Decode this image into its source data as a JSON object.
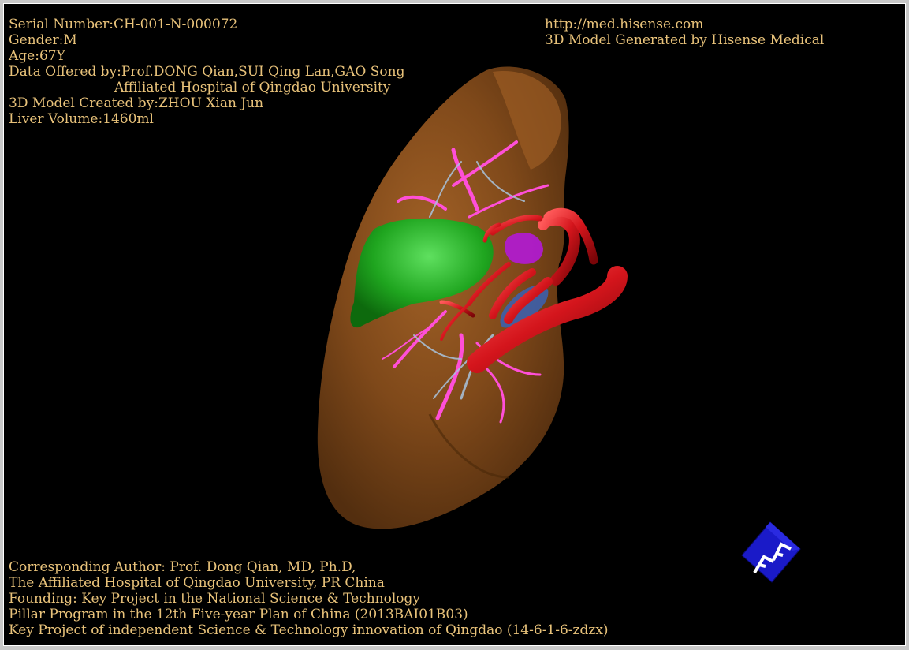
{
  "colors": {
    "text": "#e8c27a",
    "background": "#000000",
    "liver": "#8a4f1c",
    "gallbladder": "#1fa51f",
    "artery": "#d4151c",
    "vein": "#ff4fd8",
    "portal_vein": "#a9c4de",
    "cube": "#1616c8"
  },
  "info": {
    "serial": "Serial Number:CH-001-N-000072",
    "gender": "Gender:M",
    "age": "Age:67Y",
    "offered": "Data Offered by:Prof.DONG Qian,SUI Qing Lan,GAO Song",
    "hospital": "Affiliated Hospital of Qingdao University",
    "created": "3D Model Created by:ZHOU Xian Jun",
    "volume": "Liver Volume:1460ml"
  },
  "branding": {
    "url": "http://med.hisense.com",
    "generated": "3D Model Generated by Hisense Medical"
  },
  "footer": {
    "line1": "Corresponding Author: Prof. Dong Qian, MD, Ph.D,",
    "line2": "The Affiliated Hospital of Qingdao University, PR China",
    "line3": "Founding: Key Project in the National Science & Technology",
    "line4": "Pillar Program in the 12th Five-year Plan of China (2013BAI01B03)",
    "line5": "Key Project of independent Science & Technology innovation of Qingdao (14-6-1-6-zdzx)"
  },
  "orientation_cube": {
    "face_label": "FF",
    "icon": "orientation-cube-icon"
  }
}
